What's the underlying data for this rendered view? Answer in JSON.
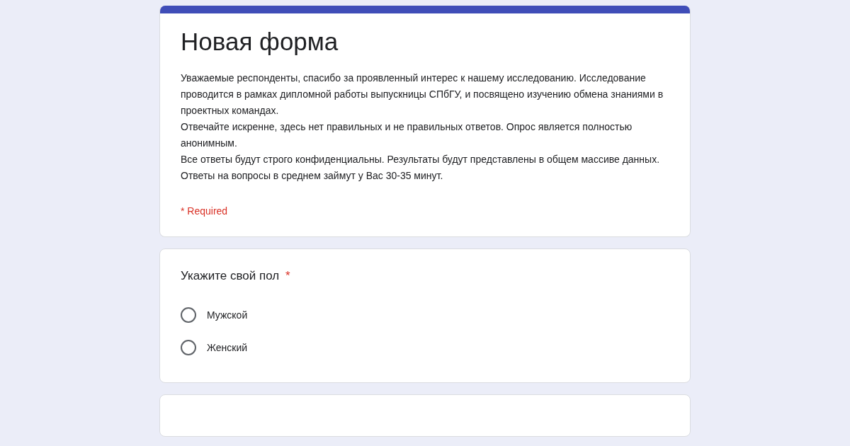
{
  "form": {
    "title": "Новая форма",
    "description": [
      "Уважаемые респонденты, спасибо за проявленный интерес к нашему исследованию. Исследование проводится в рамках дипломной работы выпускницы СПбГУ, и посвящено изучению обмена знаниями в проектных командах.",
      "Отвечайте искренне, здесь нет правильных и не правильных ответов. Опрос является полностью анонимным.",
      "Все ответы будут строго конфиденциальны. Результаты будут представлены в общем массиве данных.",
      "Ответы на вопросы в среднем займут у Вас 30-35 минут."
    ],
    "required_note": "* Required"
  },
  "questions": [
    {
      "title": "Укажите свой пол",
      "required_mark": "*",
      "options": [
        {
          "label": "Мужской",
          "selected": false
        },
        {
          "label": "Женский",
          "selected": false
        }
      ]
    }
  ]
}
